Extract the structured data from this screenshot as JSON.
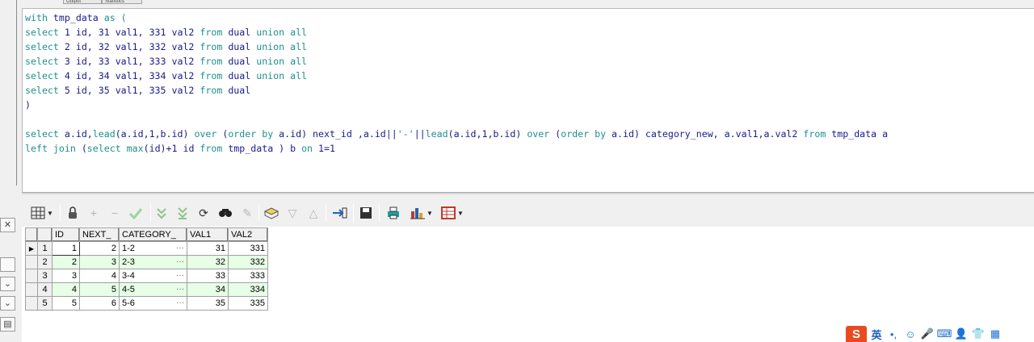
{
  "tabs": [
    "Output",
    "Statistics"
  ],
  "sql_lines": [
    [
      {
        "t": "with ",
        "c": "kw"
      },
      {
        "t": "tmp_data ",
        "c": "tx"
      },
      {
        "t": "as (",
        "c": "kw"
      }
    ],
    [
      {
        "t": "select ",
        "c": "kw"
      },
      {
        "t": "1 id, 31 val1, 331 val2 ",
        "c": "tx"
      },
      {
        "t": "from ",
        "c": "kw"
      },
      {
        "t": "dual ",
        "c": "tx"
      },
      {
        "t": "union all",
        "c": "kw"
      }
    ],
    [
      {
        "t": "select ",
        "c": "kw"
      },
      {
        "t": "2 id, 32 val1, 332 val2 ",
        "c": "tx"
      },
      {
        "t": "from ",
        "c": "kw"
      },
      {
        "t": "dual ",
        "c": "tx"
      },
      {
        "t": "union all",
        "c": "kw"
      }
    ],
    [
      {
        "t": "select ",
        "c": "kw"
      },
      {
        "t": "3 id, 33 val1, 333 val2 ",
        "c": "tx"
      },
      {
        "t": "from ",
        "c": "kw"
      },
      {
        "t": "dual ",
        "c": "tx"
      },
      {
        "t": "union all",
        "c": "kw"
      }
    ],
    [
      {
        "t": "select ",
        "c": "kw"
      },
      {
        "t": "4 id, 34 val1, 334 val2 ",
        "c": "tx"
      },
      {
        "t": "from ",
        "c": "kw"
      },
      {
        "t": "dual ",
        "c": "tx"
      },
      {
        "t": "union all",
        "c": "kw"
      }
    ],
    [
      {
        "t": "select ",
        "c": "kw"
      },
      {
        "t": "5 id, 35 val1, 335 val2 ",
        "c": "tx"
      },
      {
        "t": "from ",
        "c": "kw"
      },
      {
        "t": "dual",
        "c": "tx"
      }
    ],
    [
      {
        "t": ")",
        "c": "tx"
      }
    ],
    [],
    [
      {
        "t": "select ",
        "c": "kw"
      },
      {
        "t": "a.id,",
        "c": "tx"
      },
      {
        "t": "lead",
        "c": "kw"
      },
      {
        "t": "(a.id,1,b.id) ",
        "c": "tx"
      },
      {
        "t": "over ",
        "c": "kw"
      },
      {
        "t": "(",
        "c": "tx"
      },
      {
        "t": "order by ",
        "c": "kw"
      },
      {
        "t": "a.id) next_id ,a.id||",
        "c": "tx"
      },
      {
        "t": "'-'",
        "c": "kw"
      },
      {
        "t": "||",
        "c": "tx"
      },
      {
        "t": "lead",
        "c": "kw"
      },
      {
        "t": "(a.id,1,b.id) ",
        "c": "tx"
      },
      {
        "t": "over ",
        "c": "kw"
      },
      {
        "t": "(",
        "c": "tx"
      },
      {
        "t": "order by ",
        "c": "kw"
      },
      {
        "t": "a.id) category_new, a.val1,a.val2 ",
        "c": "tx"
      },
      {
        "t": "from ",
        "c": "kw"
      },
      {
        "t": "tmp_data a",
        "c": "tx"
      }
    ],
    [
      {
        "t": "left join ",
        "c": "kw"
      },
      {
        "t": "(",
        "c": "tx"
      },
      {
        "t": "select max",
        "c": "kw"
      },
      {
        "t": "(id)+1 id ",
        "c": "tx"
      },
      {
        "t": "from ",
        "c": "kw"
      },
      {
        "t": "tmp_data ) b ",
        "c": "tx"
      },
      {
        "t": "on ",
        "c": "kw"
      },
      {
        "t": "1=1",
        "c": "tx"
      }
    ]
  ],
  "toolbar": {
    "icons": [
      "grid-view-icon",
      "lock-icon",
      "add-row-icon",
      "delete-row-icon",
      "post-changes-icon",
      "fetch-next-icon",
      "fetch-last-icon",
      "refresh-icon",
      "find-icon",
      "clear-icon",
      "query-by-example-icon",
      "filter-down-icon",
      "filter-up-icon",
      "export-icon",
      "save-icon",
      "print-icon",
      "chart-icon",
      "table-icon"
    ]
  },
  "grid": {
    "columns": [
      "ID",
      "NEXT_",
      "CATEGORY_",
      "VAL1",
      "VAL2"
    ],
    "rows": [
      {
        "n": "1",
        "id": "1",
        "next": "2",
        "cat": "1-2",
        "v1": "31",
        "v2": "331"
      },
      {
        "n": "2",
        "id": "2",
        "next": "3",
        "cat": "2-3",
        "v1": "32",
        "v2": "332"
      },
      {
        "n": "3",
        "id": "3",
        "next": "4",
        "cat": "3-4",
        "v1": "33",
        "v2": "333"
      },
      {
        "n": "4",
        "id": "4",
        "next": "5",
        "cat": "4-5",
        "v1": "34",
        "v2": "334"
      },
      {
        "n": "5",
        "id": "5",
        "next": "6",
        "cat": "5-6",
        "v1": "35",
        "v2": "335"
      }
    ],
    "dots": "···"
  },
  "ime": {
    "logo": "S",
    "lang": "英",
    "punct": "•,",
    "emoji": "☺",
    "mic": "🎤",
    "keyboard": "⌨",
    "user": "👤",
    "shirt": "👕",
    "grid": "▦"
  }
}
